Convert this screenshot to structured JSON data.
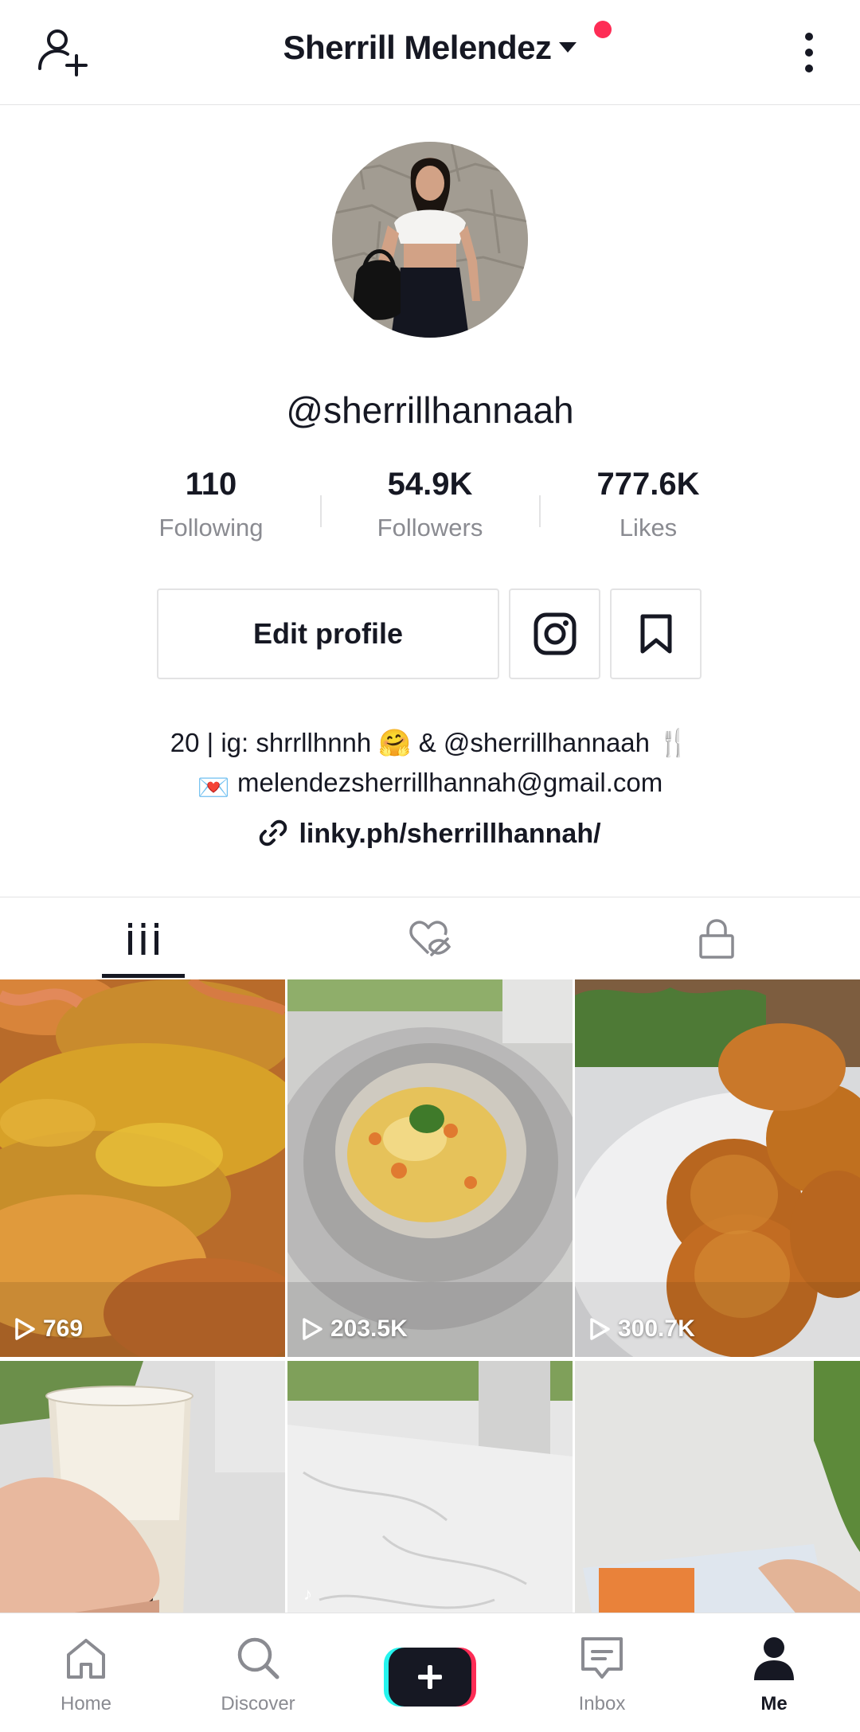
{
  "header": {
    "title": "Sherrill Melendez",
    "notification_dot_color": "#fe2c55"
  },
  "profile": {
    "username": "@sherrillhannaah",
    "stats": [
      {
        "value": "110",
        "label": "Following"
      },
      {
        "value": "54.9K",
        "label": "Followers"
      },
      {
        "value": "777.6K",
        "label": "Likes"
      }
    ],
    "edit_label": "Edit profile",
    "bio_line1": "20 | ig: shrrllhnnh 🤗 & @sherrillhannaah 🍴",
    "bio_line2_email": "melendezsherrillhannah@gmail.com",
    "bio_line2_icon": "💌",
    "link": "linky.ph/sherrillhannah/"
  },
  "tabs": [
    {
      "icon": "grid-icon",
      "active": true
    },
    {
      "icon": "liked-hidden-icon",
      "active": false
    },
    {
      "icon": "lock-icon",
      "active": false
    }
  ],
  "videos": [
    {
      "views": "769",
      "subject": "crab"
    },
    {
      "views": "203.5K",
      "subject": "fried rice"
    },
    {
      "views": "300.7K",
      "subject": "croquettes"
    },
    {
      "views": "",
      "subject": "milk tea"
    },
    {
      "views": "",
      "subject": "marble table"
    },
    {
      "views": "",
      "subject": "promo box"
    }
  ],
  "bottom_nav": [
    {
      "label": "Home",
      "icon": "home-icon"
    },
    {
      "label": "Discover",
      "icon": "search-icon"
    },
    {
      "label": "",
      "icon": "create-icon"
    },
    {
      "label": "Inbox",
      "icon": "inbox-icon"
    },
    {
      "label": "Me",
      "icon": "profile-icon",
      "active": true
    }
  ],
  "colors": {
    "accent": "#fe2c55",
    "cyan": "#25f4ee",
    "text": "#161823",
    "muted": "#8a8b91"
  }
}
